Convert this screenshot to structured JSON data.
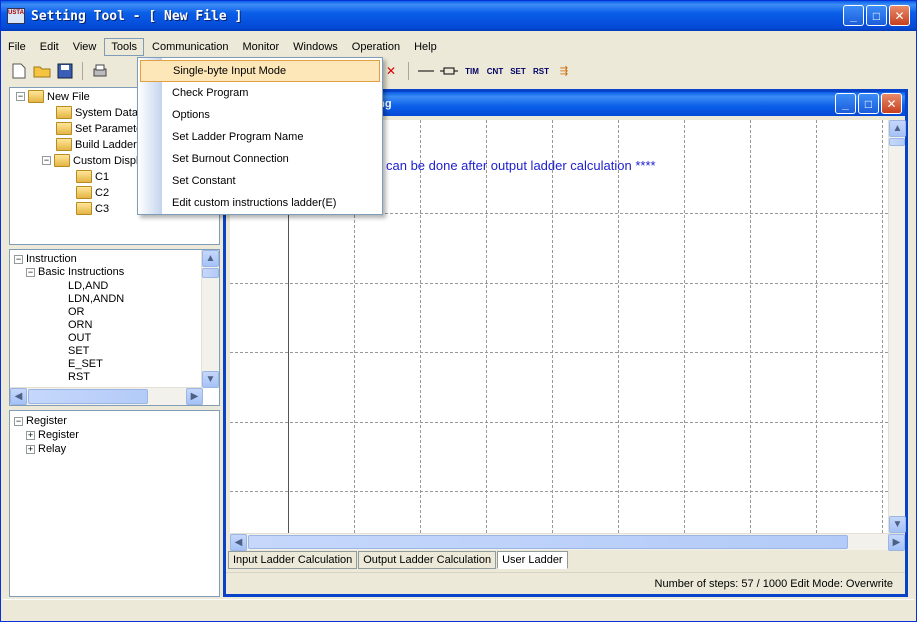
{
  "window": {
    "title": "Setting Tool - [ New File ]",
    "app_icon_text": "USTA",
    "minimize": "_",
    "maximize": "□",
    "close": "✕"
  },
  "menubar": {
    "items": [
      "File",
      "Edit",
      "View",
      "Tools",
      "Communication",
      "Monitor",
      "Windows",
      "Operation",
      "Help"
    ]
  },
  "toolbar": {
    "icons": [
      "new-file-icon",
      "open-folder-icon",
      "save-icon",
      "print-icon",
      "contact-icon",
      "delete-icon",
      "hline-icon",
      "coil-icon"
    ],
    "tim": "TIM",
    "cnt": "CNT",
    "set": "SET",
    "rst": "RST"
  },
  "tree1": {
    "root": "New File",
    "items": [
      "System Data",
      "Set Parameter",
      "Build Ladder",
      "Custom Display"
    ],
    "children": [
      "C1",
      "C2",
      "C3"
    ]
  },
  "tree2": {
    "root": "Instruction",
    "group": "Basic Instructions",
    "items": [
      "LD,AND",
      "LDN,ANDN",
      "OR",
      "ORN",
      "OUT",
      "SET",
      "E_SET",
      "RST"
    ]
  },
  "tree3": {
    "root": "Register",
    "items": [
      "Register",
      "Relay"
    ]
  },
  "tools_menu": {
    "items": [
      "Single-byte Input Mode",
      "Check Program",
      "Options",
      "Set Ladder Program Name",
      "Set Burnout Connection",
      "Set Constant",
      "Edit custom instructions ladder(E)"
    ],
    "highlighted_index": 0
  },
  "child_window": {
    "title": "ling",
    "message": "ram can be done after output ladder calculation ****",
    "tabs": [
      "Input Ladder Calculation",
      "Output Ladder Calculation",
      "User Ladder"
    ],
    "active_tab": "User Ladder",
    "status": "Number of steps: 57 / 1000 Edit Mode: Overwrite"
  },
  "colors": {
    "titlebar": "#0a5ee8",
    "message_text": "#2020d0",
    "menu_highlight": "#fde7b8"
  }
}
